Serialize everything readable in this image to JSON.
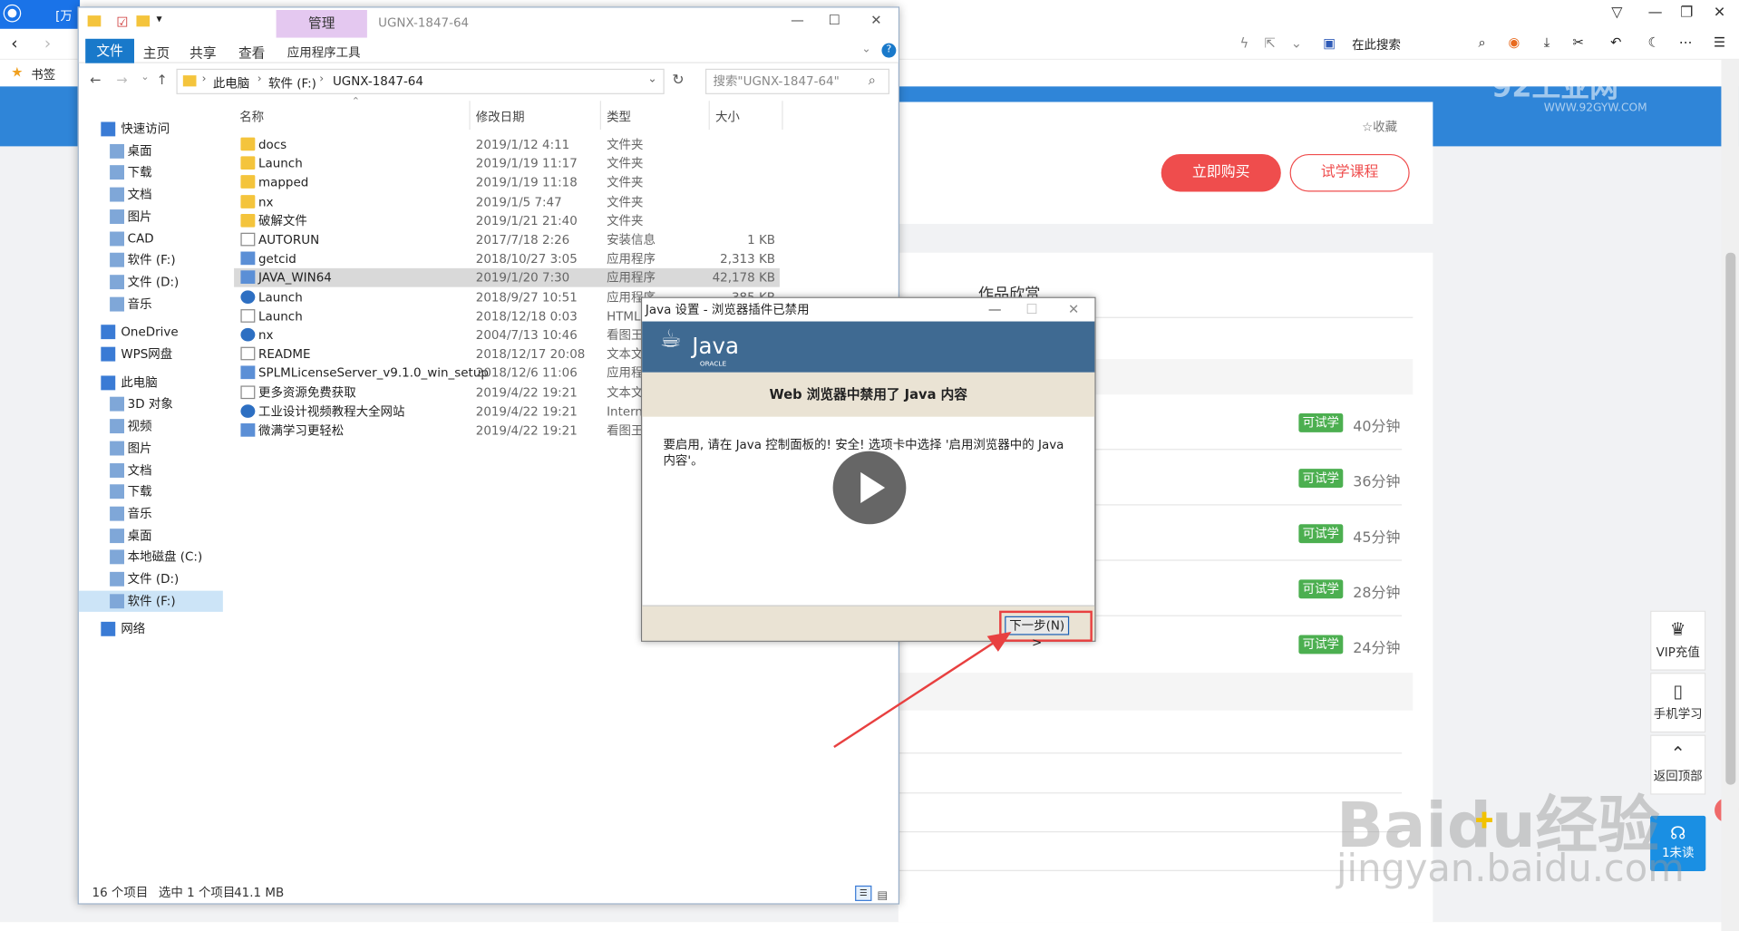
{
  "browser": {
    "tab_title": "[万",
    "search_label": "在此搜索",
    "bookmark_label": "书签"
  },
  "site": {
    "logo_text": "92工业网",
    "logo_url": "WWW.92GYW.COM",
    "collect": "☆收藏",
    "buy": "立即购买",
    "trial": "试学课程",
    "section": "作品欣赏",
    "badge": "可试学",
    "durations": [
      "40分钟",
      "36分钟",
      "45分钟",
      "28分钟",
      "24分钟"
    ],
    "side": {
      "vip": "VIP充值",
      "mobile": "手机学习",
      "top": "返回顶部",
      "unread": "1未读"
    }
  },
  "explorer": {
    "window_title": "UGNX-1847-64",
    "manage_tab": "管理",
    "app_tools": "应用程序工具",
    "ribbon": [
      "文件",
      "主页",
      "共享",
      "查看"
    ],
    "breadcrumb": [
      "此电脑",
      "软件 (F:)",
      "UGNX-1847-64"
    ],
    "search_placeholder": "搜索\"UGNX-1847-64\"",
    "nav": [
      {
        "label": "快速访问",
        "top": true
      },
      {
        "label": "桌面"
      },
      {
        "label": "下载"
      },
      {
        "label": "文档"
      },
      {
        "label": "图片"
      },
      {
        "label": "CAD"
      },
      {
        "label": "软件 (F:)"
      },
      {
        "label": "文件 (D:)"
      },
      {
        "label": "音乐"
      },
      {
        "label": "OneDrive",
        "top": true
      },
      {
        "label": "WPS网盘",
        "top": true
      },
      {
        "label": "此电脑",
        "top": true
      },
      {
        "label": "3D 对象"
      },
      {
        "label": "视频"
      },
      {
        "label": "图片"
      },
      {
        "label": "文档"
      },
      {
        "label": "下载"
      },
      {
        "label": "音乐"
      },
      {
        "label": "桌面"
      },
      {
        "label": "本地磁盘 (C:)"
      },
      {
        "label": "文件 (D:)"
      },
      {
        "label": "软件 (F:)",
        "selected": true
      },
      {
        "label": "网络",
        "top": true
      }
    ],
    "columns": [
      "名称",
      "修改日期",
      "类型",
      "大小"
    ],
    "files": [
      {
        "name": "docs",
        "date": "2019/1/12 4:11",
        "type": "文件夹",
        "size": "",
        "icon": "folder"
      },
      {
        "name": "Launch",
        "date": "2019/1/19 11:17",
        "type": "文件夹",
        "size": "",
        "icon": "folder"
      },
      {
        "name": "mapped",
        "date": "2019/1/19 11:18",
        "type": "文件夹",
        "size": "",
        "icon": "folder"
      },
      {
        "name": "nx",
        "date": "2019/1/5 7:47",
        "type": "文件夹",
        "size": "",
        "icon": "folder"
      },
      {
        "name": "破解文件",
        "date": "2019/1/21 21:40",
        "type": "文件夹",
        "size": "",
        "icon": "folder"
      },
      {
        "name": "AUTORUN",
        "date": "2017/7/18 2:26",
        "type": "安装信息",
        "size": "1 KB",
        "icon": "txt"
      },
      {
        "name": "getcid",
        "date": "2018/10/27 3:05",
        "type": "应用程序",
        "size": "2,313 KB",
        "icon": "app"
      },
      {
        "name": "JAVA_WIN64",
        "date": "2019/1/20 7:30",
        "type": "应用程序",
        "size": "42,178 KB",
        "icon": "app",
        "selected": true
      },
      {
        "name": "Launch",
        "date": "2018/9/27 10:51",
        "type": "应用程序",
        "size": "385 KB",
        "icon": "globe"
      },
      {
        "name": "Launch",
        "date": "2018/12/18 0:03",
        "type": "HTML",
        "size": "",
        "icon": "txt"
      },
      {
        "name": "nx",
        "date": "2004/7/13 10:46",
        "type": "看图王",
        "size": "",
        "icon": "globe"
      },
      {
        "name": "README",
        "date": "2018/12/17 20:08",
        "type": "文本文",
        "size": "",
        "icon": "txt"
      },
      {
        "name": "SPLMLicenseServer_v9.1.0_win_setup",
        "date": "2018/12/6 11:06",
        "type": "应用程",
        "size": "",
        "icon": "app"
      },
      {
        "name": "更多资源免费获取",
        "date": "2019/4/22 19:21",
        "type": "文本文",
        "size": "",
        "icon": "txt"
      },
      {
        "name": "工业设计视频教程大全网站",
        "date": "2019/4/22 19:21",
        "type": "Interne",
        "size": "",
        "icon": "globe"
      },
      {
        "name": "微满学习更轻松",
        "date": "2019/4/22 19:21",
        "type": "看图王",
        "size": "",
        "icon": "app"
      }
    ],
    "status_count": "16 个项目",
    "status_selected": "选中 1 个项目",
    "status_size": "41.1 MB"
  },
  "java": {
    "title": "Java 设置 - 浏览器插件已禁用",
    "brand": "Java",
    "brand_sub": "ORACLE",
    "heading": "Web 浏览器中禁用了 Java 内容",
    "body": "要启用, 请在 Java 控制面板的! 安全! 选项卡中选择 '启用浏览器中的 Java 内容'。",
    "next": "下一步(N) >"
  },
  "watermark": {
    "brand": "Baidu经验",
    "url": "jingyan.baidu.com"
  }
}
